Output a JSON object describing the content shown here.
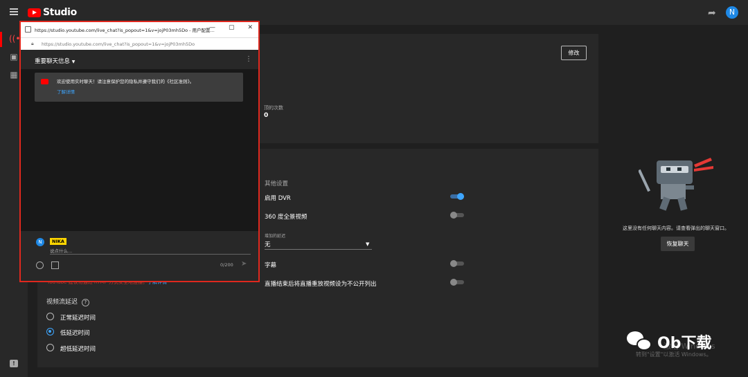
{
  "app": {
    "logo_text": "Studio",
    "avatar_letter": "N"
  },
  "topbar": {
    "share_icon": "share-arrow-icon"
  },
  "rail": {
    "items": [
      "live-icon",
      "camera-icon",
      "calendar-icon"
    ],
    "feedback_icon": "feedback-icon"
  },
  "stream_panel": {
    "edit_button": "修改",
    "stat_label": "顶的次数",
    "stat_value": "0"
  },
  "settings": {
    "other_settings_title": "其他设置",
    "dvr_label": "启用 DVR",
    "dvr_on": true,
    "vr360_label": "360 度全景视频",
    "vr360_on": false,
    "latency_dropdown_label": "增加的延迟",
    "latency_dropdown_value": "无",
    "captions_label": "字幕",
    "captions_on": false,
    "unlisted_label": "直播结束后将直播重放视频设为不公开列出",
    "unlisted_on": false,
    "rtmp_notice": "YouTube 建议勿通过 RTMP 方式安全地连接。",
    "rtmp_notice_link": "了解详情",
    "latency_section_title": "视频流延迟",
    "latency_options": [
      "正常延迟时间",
      "低延迟时间",
      "超低延迟时间"
    ],
    "latency_selected_index": 1
  },
  "popup": {
    "window_title": "https://studio.youtube.com/live_chat?is_popout=1&v=jojP03mh5Do - 用户配置...",
    "url": "https://studio.youtube.com/live_chat?is_popout=1&v=jojP03mh5Do",
    "chat_header": "重要聊天信息",
    "welcome_text": "欢迎使用实时聊天！请注意保护您的隐私并遵守我们的《社区准则》。",
    "welcome_link": "了解详情",
    "user_name": "NIKA",
    "input_placeholder": "说点什么...",
    "counter": "0/200",
    "user_avatar_letter": "N"
  },
  "right_pane": {
    "empty_text": "这里没有任何聊天内容。请查看弹出的聊天窗口。",
    "restore_button": "恢复聊天",
    "activate_windows_1": "激活 Windows",
    "activate_windows_2": "转到\"设置\"以激活 Windows。",
    "brand_badge": "Ob下载"
  },
  "colors": {
    "accent_red": "#ff0000",
    "accent_blue": "#3ea6ff",
    "highlight_border": "#e0281e"
  }
}
